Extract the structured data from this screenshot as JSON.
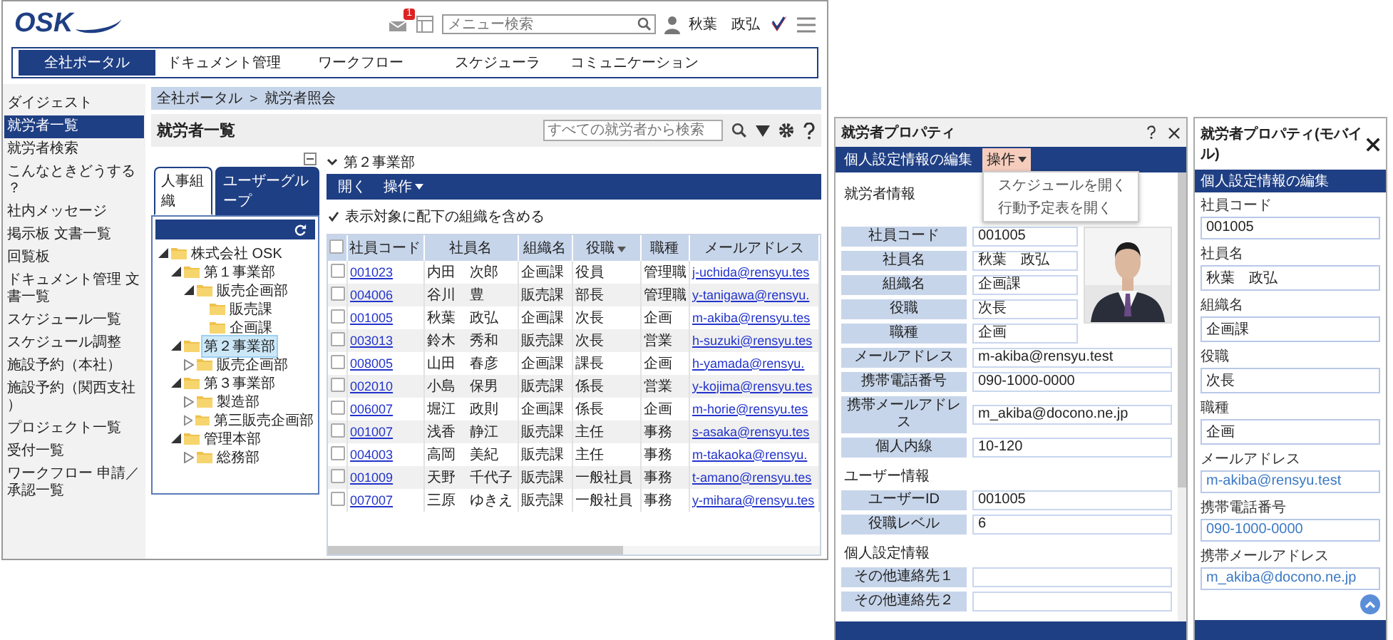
{
  "header": {
    "logo": "OSK",
    "notification_badge": "1",
    "menu_search": {
      "placeholder": "メニュー検索"
    },
    "user_name": "秋葉　政弘"
  },
  "nav_tabs": [
    {
      "label": "全社ポータル",
      "selected": true
    },
    {
      "label": "ドキュメント管理",
      "selected": false
    },
    {
      "label": "ワークフロー",
      "selected": false
    },
    {
      "label": "スケジューラ",
      "selected": false
    },
    {
      "label": "コミュニケーション",
      "selected": false
    }
  ],
  "sidebar": {
    "items": [
      {
        "label": "ダイジェスト",
        "selected": false
      },
      {
        "label": "就労者一覧",
        "selected": true
      },
      {
        "label": "就労者検索",
        "selected": false
      },
      {
        "label": "こんなときどうする？",
        "selected": false
      },
      {
        "label": "社内メッセージ",
        "selected": false
      },
      {
        "label": "掲示板 文書一覧",
        "selected": false
      },
      {
        "label": "回覧板",
        "selected": false
      },
      {
        "label": "ドキュメント管理 文書一覧",
        "selected": false
      },
      {
        "label": "スケジュール一覧",
        "selected": false
      },
      {
        "label": "スケジュール調整",
        "selected": false
      },
      {
        "label": "施設予約（本社）",
        "selected": false
      },
      {
        "label": "施設予約（関西支社）",
        "selected": false
      },
      {
        "label": "プロジェクト一覧",
        "selected": false
      },
      {
        "label": "受付一覧",
        "selected": false
      },
      {
        "label": "ワークフロー 申請／承認一覧",
        "selected": false
      }
    ]
  },
  "breadcrumb": "全社ポータル ＞ 就労者照会",
  "page_title": "就労者一覧",
  "employee_search": {
    "placeholder": "すべての就労者から検索"
  },
  "org_tabs": [
    {
      "label": "人事組織",
      "selected": true
    },
    {
      "label": "ユーザーグループ",
      "selected": false
    }
  ],
  "tree": [
    {
      "label": "株式会社 OSK",
      "expanded": true,
      "selected": false,
      "children": [
        {
          "label": "第１事業部",
          "expanded": true,
          "selected": false,
          "children": [
            {
              "label": "販売企画部",
              "expanded": true,
              "selected": false,
              "children": [
                {
                  "label": "販売課",
                  "selected": false
                },
                {
                  "label": "企画課",
                  "selected": false
                }
              ]
            }
          ]
        },
        {
          "label": "第２事業部",
          "expanded": true,
          "selected": true,
          "children": [
            {
              "label": "販売企画部",
              "expanded": false,
              "selected": false
            }
          ]
        },
        {
          "label": "第３事業部",
          "expanded": true,
          "selected": false,
          "children": [
            {
              "label": "製造部",
              "expanded": false,
              "selected": false
            },
            {
              "label": "第三販売企画部",
              "expanded": false,
              "selected": false
            }
          ]
        },
        {
          "label": "管理本部",
          "expanded": true,
          "selected": false,
          "children": [
            {
              "label": "総務部",
              "expanded": false,
              "selected": false
            }
          ]
        }
      ]
    }
  ],
  "detail": {
    "heading": "第２事業部",
    "toolbar": [
      {
        "label": "開く",
        "dropdown": false
      },
      {
        "label": "操作",
        "dropdown": true
      }
    ],
    "include_sub": {
      "label": "表示対象に配下の組織を含める",
      "checked": true
    }
  },
  "table": {
    "select_all": {
      "checked": false
    },
    "columns": [
      {
        "label": "社員コード",
        "sorted": false,
        "link": true
      },
      {
        "label": "社員名",
        "sorted": false,
        "link": false
      },
      {
        "label": "組織名",
        "sorted": false,
        "link": false
      },
      {
        "label": "役職",
        "sorted": true,
        "link": false
      },
      {
        "label": "職種",
        "sorted": false,
        "link": false
      },
      {
        "label": "メールアドレス",
        "sorted": false,
        "link": true
      }
    ],
    "rows": [
      {
        "checked": false,
        "cells": [
          "001023",
          "内田　次郎",
          "企画課",
          "役員",
          "管理職",
          "j-uchida@rensyu.tes"
        ]
      },
      {
        "checked": false,
        "cells": [
          "004006",
          "谷川　豊",
          "販売課",
          "部長",
          "管理職",
          "y-tanigawa@rensyu."
        ]
      },
      {
        "checked": false,
        "cells": [
          "001005",
          "秋葉　政弘",
          "企画課",
          "次長",
          "企画",
          "m-akiba@rensyu.tes"
        ]
      },
      {
        "checked": false,
        "cells": [
          "003013",
          "鈴木　秀和",
          "販売課",
          "次長",
          "営業",
          "h-suzuki@rensyu.tes"
        ]
      },
      {
        "checked": false,
        "cells": [
          "008005",
          "山田　春彦",
          "企画課",
          "課長",
          "企画",
          "h-yamada@rensyu."
        ]
      },
      {
        "checked": false,
        "cells": [
          "002010",
          "小島　保男",
          "販売課",
          "係長",
          "営業",
          "y-kojima@rensyu.tes"
        ]
      },
      {
        "checked": false,
        "cells": [
          "006007",
          "堀江　政則",
          "企画課",
          "係長",
          "企画",
          "m-horie@rensyu.tes"
        ]
      },
      {
        "checked": false,
        "cells": [
          "001007",
          "浅香　静江",
          "販売課",
          "主任",
          "事務",
          "s-asaka@rensyu.tes"
        ]
      },
      {
        "checked": false,
        "cells": [
          "004003",
          "高岡　美紀",
          "販売課",
          "主任",
          "事務",
          "m-takaoka@rensyu."
        ]
      },
      {
        "checked": false,
        "cells": [
          "001009",
          "天野　千代子",
          "販売課",
          "一般社員",
          "事務",
          "t-amano@rensyu.tes"
        ]
      },
      {
        "checked": false,
        "cells": [
          "007007",
          "三原　ゆきえ",
          "販売課",
          "一般社員",
          "事務",
          "y-mihara@rensyu.tes"
        ]
      }
    ]
  },
  "property_window": {
    "title": "就労者プロパティ",
    "toolbar": [
      {
        "label": "個人設定情報の編集",
        "dropdown": false,
        "open": false
      },
      {
        "label": "操作",
        "dropdown": true,
        "open": true
      }
    ],
    "menu": [
      "スケジュールを開く",
      "行動予定表を開く"
    ],
    "photo": {
      "kind": "picture"
    },
    "sections": [
      {
        "title": "就労者情報",
        "fields": [
          {
            "label": "社員コード",
            "value": "001005"
          },
          {
            "label": "社員名",
            "value": "秋葉　政弘"
          },
          {
            "label": "組織名",
            "value": "企画課"
          },
          {
            "label": "役職",
            "value": "次長"
          },
          {
            "label": "職種",
            "value": "企画"
          },
          {
            "label": "メールアドレス",
            "value": "m-akiba@rensyu.test"
          },
          {
            "label": "携帯電話番号",
            "value": "090-1000-0000"
          },
          {
            "label": "携帯メールアドレス",
            "value": "m_akiba@docono.ne.jp"
          },
          {
            "label": "個人内線",
            "value": "10-120"
          }
        ]
      },
      {
        "title": "ユーザー情報",
        "fields": [
          {
            "label": "ユーザーID",
            "value": "001005"
          },
          {
            "label": "役職レベル",
            "value": "6"
          }
        ]
      },
      {
        "title": "個人設定情報",
        "fields": [
          {
            "label": "その他連絡先１"
          },
          {
            "label": "その他連絡先２"
          }
        ]
      }
    ]
  },
  "mobile_window": {
    "title": "就労者プロパティ(モバイル)",
    "bar": "個人設定情報の編集",
    "fields": [
      {
        "label": "社員コード",
        "value": "001005",
        "link": false
      },
      {
        "label": "社員名",
        "value": "秋葉　政弘",
        "link": false
      },
      {
        "label": "組織名",
        "value": "企画課",
        "link": false
      },
      {
        "label": "役職",
        "value": "次長",
        "link": false
      },
      {
        "label": "職種",
        "value": "企画",
        "link": false
      },
      {
        "label": "メールアドレス",
        "value": "m-akiba@rensyu.test",
        "link": true
      },
      {
        "label": "携帯電話番号",
        "value": "090-1000-0000",
        "link": true
      },
      {
        "label": "携帯メールアドレス",
        "value": "m_akiba@docono.ne.jp",
        "link": true
      }
    ]
  }
}
